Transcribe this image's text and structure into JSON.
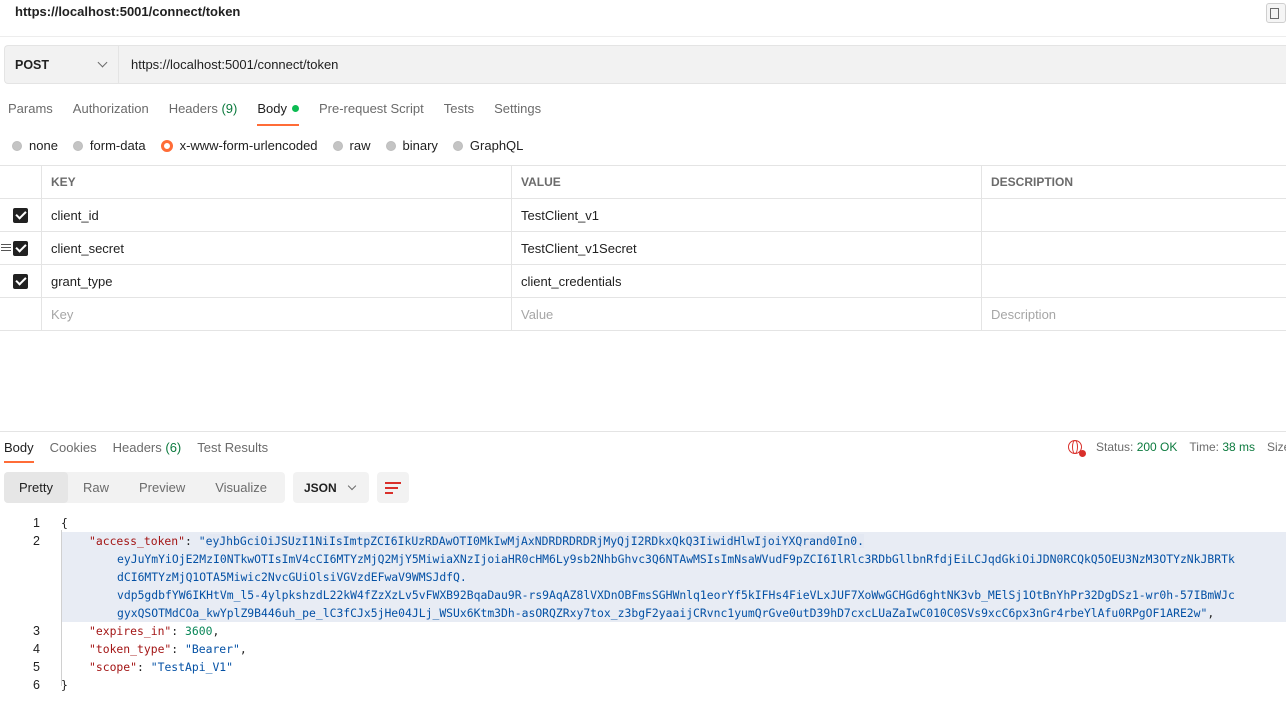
{
  "window": {
    "title": "https://localhost:5001/connect/token"
  },
  "request": {
    "method": "POST",
    "url": "https://localhost:5001/connect/token",
    "tabs": [
      {
        "label": "Params"
      },
      {
        "label": "Authorization"
      },
      {
        "label": "Headers",
        "count": "(9)"
      },
      {
        "label": "Body"
      },
      {
        "label": "Pre-request Script"
      },
      {
        "label": "Tests"
      },
      {
        "label": "Settings"
      }
    ],
    "body_types": [
      "none",
      "form-data",
      "x-www-form-urlencoded",
      "raw",
      "binary",
      "GraphQL"
    ],
    "selected_body_type": "x-www-form-urlencoded",
    "table": {
      "headers": [
        "KEY",
        "VALUE",
        "DESCRIPTION"
      ],
      "rows": [
        {
          "key": "client_id",
          "value": "TestClient_v1",
          "description": ""
        },
        {
          "key": "client_secret",
          "value": "TestClient_v1Secret",
          "description": ""
        },
        {
          "key": "grant_type",
          "value": "client_credentials",
          "description": ""
        }
      ],
      "placeholders": {
        "key": "Key",
        "value": "Value",
        "description": "Description"
      }
    }
  },
  "response": {
    "tabs": [
      {
        "label": "Body"
      },
      {
        "label": "Cookies"
      },
      {
        "label": "Headers",
        "count": "(6)"
      },
      {
        "label": "Test Results"
      }
    ],
    "status_label": "Status:",
    "status_value": "200 OK",
    "time_label": "Time:",
    "time_value": "38 ms",
    "size_label": "Size",
    "views": [
      "Pretty",
      "Raw",
      "Preview",
      "Visualize"
    ],
    "format": "JSON",
    "line_numbers": [
      "1",
      "2",
      "3",
      "4",
      "5",
      "6"
    ],
    "json": {
      "open": "{",
      "close": "}",
      "access_token_key": "\"access_token\"",
      "access_token_lines": [
        "eyJhbGciOiJSUzI1NiIsImtpZCI6IkUzRDAwOTI0MkIwMjAxNDRDRDRDRjMyQjI2RDkxQkQ3IiwidHlwIjoiYXQrand0In0.",
        "eyJuYmYiOjE2MzI0NTkwOTIsImV4cCI6MTYzMjQ2MjY5MiwiaXNzIjoiaHR0cHM6Ly9sb2NhbGhvc3Q6NTAwMSIsImNsaWVudF9pZCI6IlRlc3RDbGllbnRfdjEiLCJqdGkiOiJDN0RCQkQ5OEU3NzM3OTYzNkJBRTk",
        "dCI6MTYzMjQ1OTA5Miwic2NvcGUiOlsiVGVzdEFwaV9WMSJdfQ.",
        "vdp5gdbfYW6IKHtVm_l5-4ylpkshzdL22kW4fZzXzLv5vFWXB92BqaDau9R-rs9AqAZ8lVXDnOBFmsSGHWnlq1eorYf5kIFHs4FieVLxJUF7XoWwGCHGd6ghtNK3vb_MElSj1OtBnYhPr32DgDSz1-wr0h-57IBmWJc",
        "gyxQSOTMdCOa_kwYplZ9B446uh_pe_lC3fCJx5jHe04JLj_WSUx6Ktm3Dh-asORQZRxy7tox_z3bgF2yaaijCRvnc1yumQrGve0utD39hD7cxcLUaZaIwC010C0SVs9xcC6px3nGr4rbeYlAfu0RPgOF1ARE2w"
      ],
      "expires_in_key": "\"expires_in\"",
      "expires_in_value": "3600",
      "token_type_key": "\"token_type\"",
      "token_type_value": "\"Bearer\"",
      "scope_key": "\"scope\"",
      "scope_value": "\"TestApi_V1\""
    }
  },
  "colors": {
    "accent": "#ff6c37",
    "success": "#0c7a3e",
    "dot": "#0cbb52"
  },
  "icons": {
    "corner": "layout-icon",
    "method_chevron": "chevron-down-icon",
    "drag": "drag-handle-icon",
    "globe": "globe-icon",
    "wrap": "wrap-lines-icon"
  }
}
